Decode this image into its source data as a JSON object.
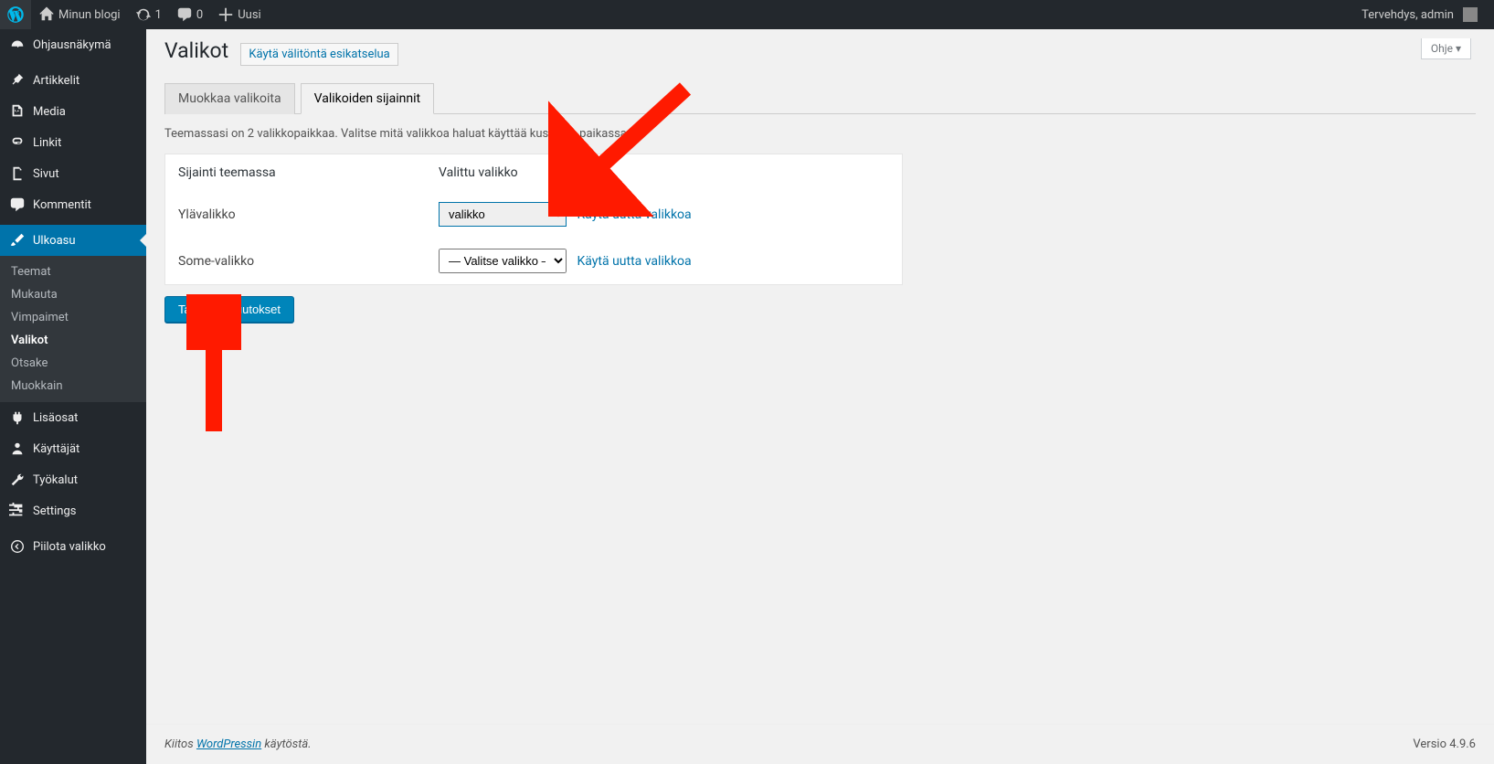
{
  "adminbar": {
    "site_name": "Minun blogi",
    "updates": "1",
    "comments": "0",
    "new_label": "Uusi",
    "greeting": "Tervehdys, admin"
  },
  "sidebar": {
    "dashboard": "Ohjausnäkymä",
    "posts": "Artikkelit",
    "media": "Media",
    "links": "Linkit",
    "pages": "Sivut",
    "comments": "Kommentit",
    "appearance": "Ulkoasu",
    "appearance_sub": {
      "themes": "Teemat",
      "customize": "Mukauta",
      "widgets": "Vimpaimet",
      "menus": "Valikot",
      "header": "Otsake",
      "editor": "Muokkain"
    },
    "plugins": "Lisäosat",
    "users": "Käyttäjät",
    "tools": "Työkalut",
    "settings": "Settings",
    "collapse": "Piilota valikko"
  },
  "page": {
    "help": "Ohje",
    "title": "Valikot",
    "title_action": "Käytä välitöntä esikatselua",
    "tab_edit": "Muokkaa valikoita",
    "tab_locations": "Valikoiden sijainnit",
    "description": "Teemassasi on 2 valikkopaikkaa. Valitse mitä valikkoa haluat käyttää kussakin paikassa.",
    "table": {
      "col_location": "Sijainti teemassa",
      "col_menu": "Valittu valikko",
      "rows": [
        {
          "label": "Ylävalikko",
          "selected": "valikko",
          "link": "Käytä uutta valikkoa"
        },
        {
          "label": "Some-valikko",
          "selected": "— Valitse valikko —",
          "link": "Käytä uutta valikkoa"
        }
      ]
    },
    "save": "Tallenna muutokset"
  },
  "footer": {
    "prefix": "Kiitos ",
    "link": "WordPressin",
    "suffix": " käytöstä.",
    "version": "Versio 4.9.6"
  }
}
